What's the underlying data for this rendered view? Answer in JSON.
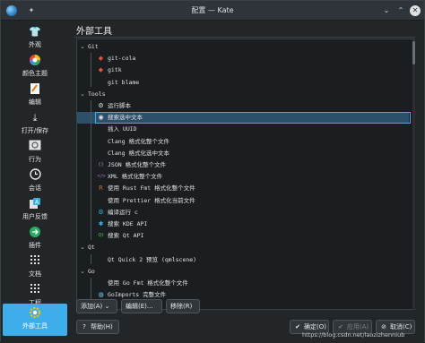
{
  "window": {
    "title": "配置 — Kate"
  },
  "sidebar": {
    "items": [
      {
        "label": "外观",
        "icon": "shirt-icon"
      },
      {
        "label": "颜色主题",
        "icon": "color-wheel-icon"
      },
      {
        "label": "编辑",
        "icon": "edit-icon"
      },
      {
        "label": "打开/保存",
        "icon": "download-icon"
      },
      {
        "label": "行为",
        "icon": "gear-icon"
      },
      {
        "label": "会话",
        "icon": "clock-icon"
      },
      {
        "label": "用户反馈",
        "icon": "feedback-icon"
      },
      {
        "label": "插件",
        "icon": "plugin-icon"
      },
      {
        "label": "文档",
        "icon": "documents-icon"
      },
      {
        "label": "工程",
        "icon": "project-icon"
      },
      {
        "label": "外部工具",
        "icon": "external-tools-icon",
        "active": true
      }
    ]
  },
  "panel": {
    "title": "外部工具"
  },
  "tree": {
    "rows": [
      {
        "text": "Git",
        "type": "group"
      },
      {
        "text": "git-cola",
        "icon": "git-diamond-icon",
        "color": "#e2553a"
      },
      {
        "text": "gitk",
        "icon": "git-diamond-icon",
        "color": "#e2553a"
      },
      {
        "text": "git blame",
        "icon": ""
      },
      {
        "text": "Tools",
        "type": "group"
      },
      {
        "text": "运行脚本",
        "icon": "run-script-icon",
        "color": "#dfe1e3"
      },
      {
        "text": "搜索选中文本",
        "icon": "search-globe-icon",
        "color": "#dfe1e3",
        "selected": true
      },
      {
        "text": "插入 UUID",
        "icon": ""
      },
      {
        "text": "Clang 格式化整个文件",
        "icon": ""
      },
      {
        "text": "Clang 格式化选中文本",
        "icon": ""
      },
      {
        "text": "JSON 格式化整个文件",
        "icon": "curly-braces-icon",
        "color": "#b07ad6"
      },
      {
        "text": "XML 格式化整个文件",
        "icon": "angle-brackets-icon",
        "color": "#b07ad6"
      },
      {
        "text": "使用 Rust Fmt 格式化整个文件",
        "icon": "rust-icon",
        "color": "#c86f2e"
      },
      {
        "text": "使用 Prettier 格式化当前文件",
        "icon": ""
      },
      {
        "text": "编译运行 c",
        "icon": "compile-run-icon",
        "color": "#3daee9"
      },
      {
        "text": "搜索 KDE API",
        "icon": "kde-icon",
        "color": "#3daee9"
      },
      {
        "text": "搜索 Qt API",
        "icon": "qt-icon",
        "color": "#41cd52"
      },
      {
        "text": "Qt",
        "type": "group"
      },
      {
        "text": "Qt Quick 2 预览 (qmlscene)",
        "icon": ""
      },
      {
        "text": "Go",
        "type": "group"
      },
      {
        "text": "使用 Go Fmt 格式化整个文件",
        "icon": ""
      },
      {
        "text": "GoImports 完整文件",
        "icon": "go-gopher-icon",
        "color": "#79d4fd"
      }
    ]
  },
  "buttons": {
    "add": "添加(A)",
    "edit": "编辑(E)...",
    "remove": "移除(R)",
    "help": "帮助(H)",
    "ok": "确定(O)",
    "apply": "应用(A)",
    "cancel": "取消(C)"
  },
  "watermark": "https://blog.csdn.net/laozizhenniub"
}
